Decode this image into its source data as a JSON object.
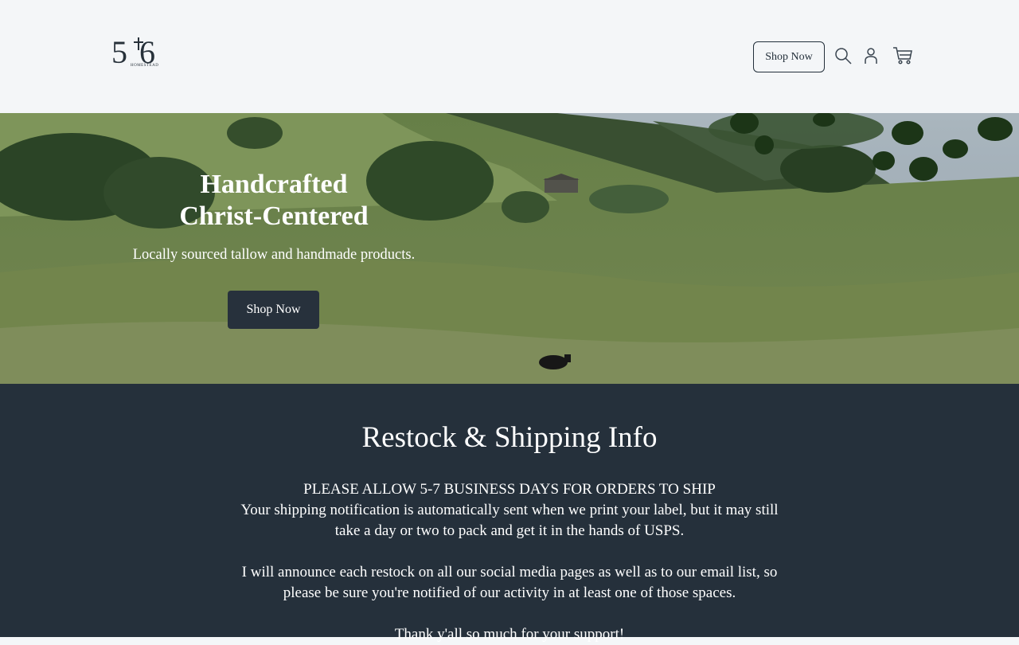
{
  "header": {
    "logo": {
      "main": "5:16",
      "sub": "HOMESTEAD"
    },
    "shop_label": "Shop Now",
    "icons": [
      "search-icon",
      "account-icon",
      "cart-icon"
    ]
  },
  "hero": {
    "title_line1": "Handcrafted",
    "title_line2": "Christ-Centered",
    "subtitle": "Locally sourced tallow and handmade products.",
    "cta_label": "Shop Now"
  },
  "info": {
    "title": "Restock & Shipping Info",
    "heading": "PLEASE ALLOW 5-7 BUSINESS DAYS FOR ORDERS TO SHIP",
    "paragraph1": "Your shipping notification is automatically sent when we print your label, but it may still take a day or two to pack and get it in the hands of USPS.",
    "paragraph2": "I will announce each restock on all our social media pages as well as to our email list, so please be sure you're notified of our activity in at least one of those spaces.",
    "paragraph3": "Thank y'all so much for your support!"
  },
  "colors": {
    "header_bg": "#f4f6f8",
    "primary_dark": "#25303b",
    "text_light": "#ffffff"
  }
}
